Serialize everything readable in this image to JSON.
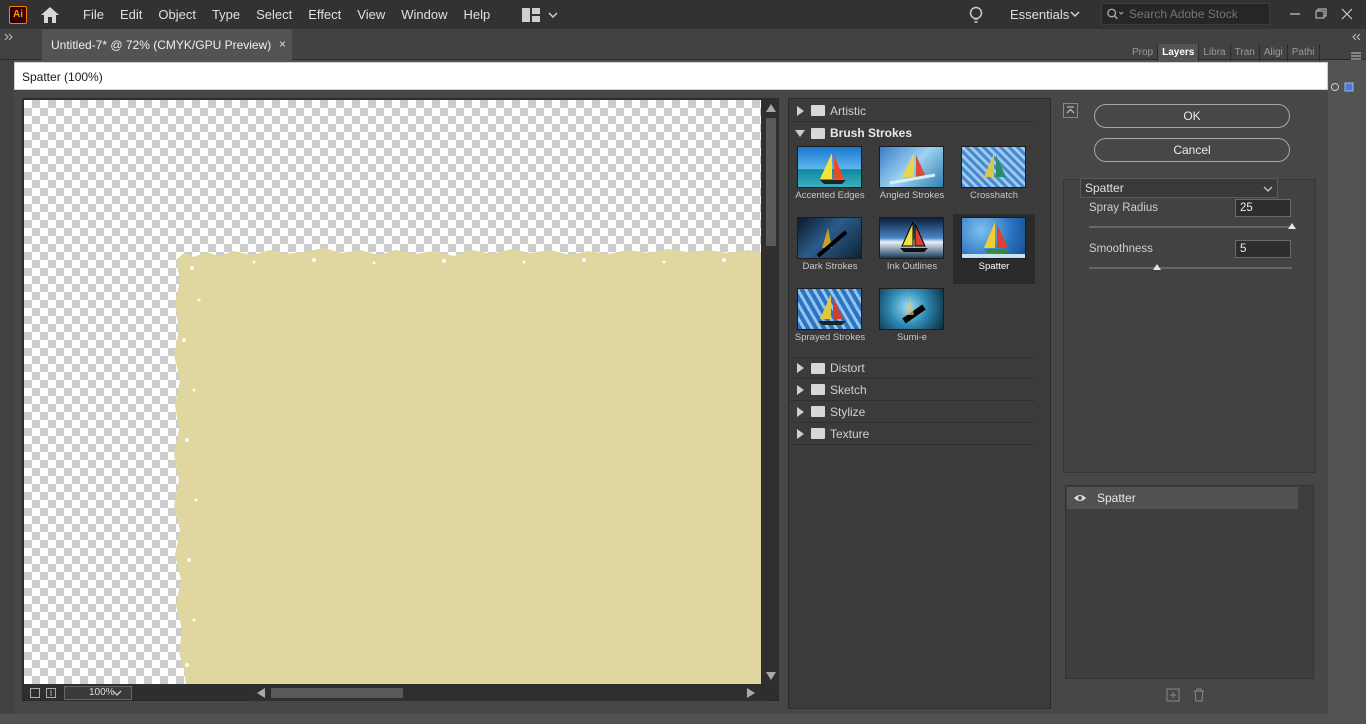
{
  "app": {
    "logo": "Ai",
    "menu": [
      "File",
      "Edit",
      "Object",
      "Type",
      "Select",
      "Effect",
      "View",
      "Window",
      "Help"
    ],
    "workspace": "Essentials",
    "search_placeholder": "Search Adobe Stock"
  },
  "document_tab": {
    "title": "Untitled-7* @ 72% (CMYK/GPU Preview)",
    "close": "×"
  },
  "right_panel_tabs": [
    "Prop",
    "Layers",
    "Libra",
    "Tran",
    "Aligi",
    "Pathi"
  ],
  "dialog": {
    "title": "Spatter (100%)",
    "preview": {
      "zoom": "100%",
      "fill_color": "#dfd6a0"
    },
    "gallery": {
      "folders_top": [
        {
          "label": "Artistic",
          "expanded": false
        },
        {
          "label": "Brush Strokes",
          "expanded": true
        }
      ],
      "brush_strokes": [
        {
          "label": "Accented Edges"
        },
        {
          "label": "Angled Strokes"
        },
        {
          "label": "Crosshatch"
        },
        {
          "label": "Dark Strokes"
        },
        {
          "label": "Ink Outlines"
        },
        {
          "label": "Spatter",
          "selected": true
        },
        {
          "label": "Sprayed Strokes"
        },
        {
          "label": "Sumi-e"
        }
      ],
      "folders_bottom": [
        "Distort",
        "Sketch",
        "Stylize",
        "Texture"
      ]
    },
    "buttons": {
      "ok": "OK",
      "cancel": "Cancel"
    },
    "settings": {
      "filter": "Spatter",
      "params": [
        {
          "label": "Spray Radius",
          "value": "25",
          "max": 25
        },
        {
          "label": "Smoothness",
          "value": "5",
          "max": 15
        }
      ]
    },
    "effect_layers": [
      {
        "label": "Spatter",
        "visible": true
      }
    ]
  }
}
